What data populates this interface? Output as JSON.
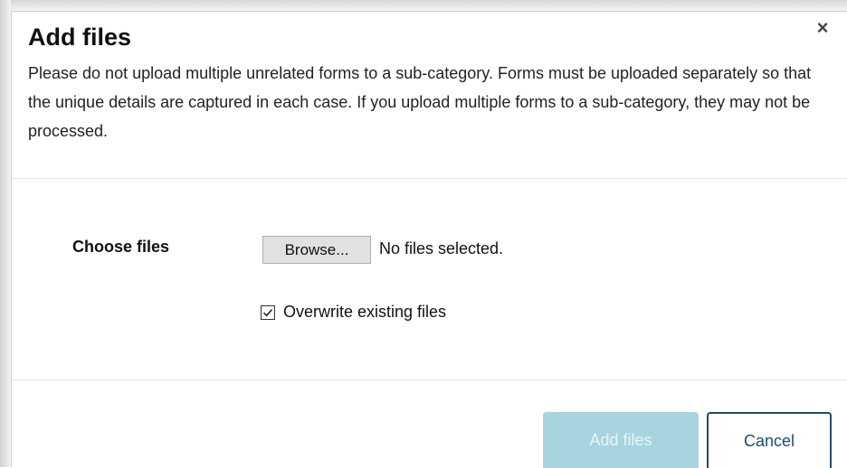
{
  "dialog": {
    "title": "Add files",
    "close_glyph": "×",
    "description": "Please do not upload multiple unrelated forms to a sub-category. Forms must be uploaded separately so that the unique details are captured in each case. If you upload multiple forms to a sub-category, they may not be processed."
  },
  "form": {
    "choose_files_label": "Choose files",
    "browse_label": "Browse...",
    "file_status": "No files selected.",
    "overwrite_label": "Overwrite existing files",
    "overwrite_checked": true
  },
  "footer": {
    "add_label": "Add files",
    "cancel_label": "Cancel"
  },
  "colors": {
    "add_button_bg": "#a7d4df",
    "cancel_border": "#1f4b6b"
  },
  "icons": {
    "close": "close-icon",
    "checkbox": "checkmark-icon"
  }
}
